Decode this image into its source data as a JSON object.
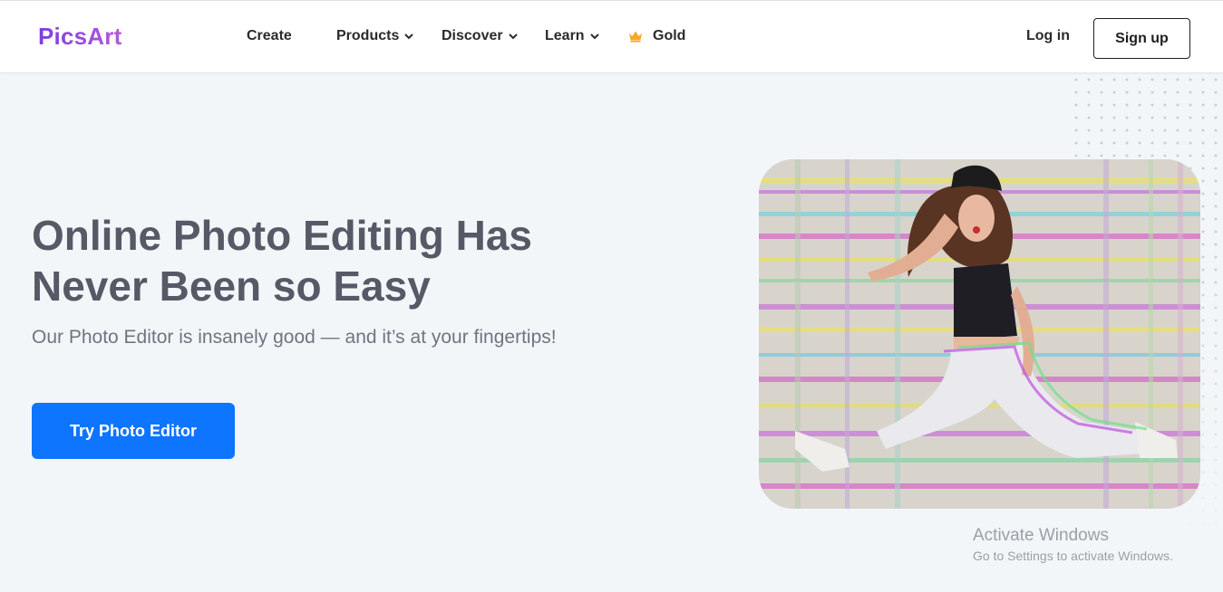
{
  "brand": {
    "logo_text": "PicsArt",
    "accent": "#7b3fe4"
  },
  "nav": {
    "create": "Create",
    "products": "Products",
    "discover": "Discover",
    "learn": "Learn",
    "gold": "Gold",
    "login": "Log in",
    "signup": "Sign up"
  },
  "hero": {
    "title_line1": "Online Photo Editing Has",
    "title_line2": "Never Been so Easy",
    "subtitle": "Our Photo Editor is insanely good — and it’s at your fingertips!",
    "cta_label": "Try Photo Editor",
    "cta_color": "#0d75ff"
  },
  "watermark": {
    "title": "Activate Windows",
    "subtitle": "Go to Settings to activate Windows."
  }
}
